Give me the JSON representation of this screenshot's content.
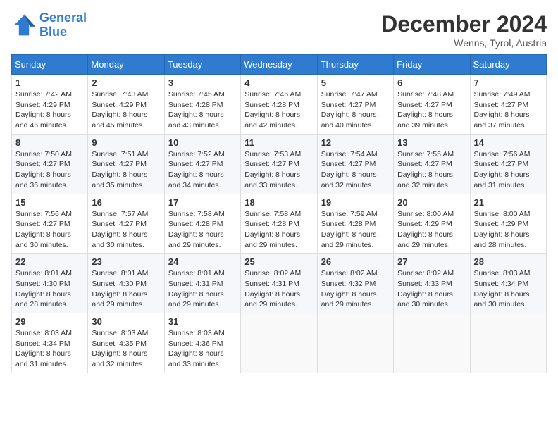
{
  "logo": {
    "line1": "General",
    "line2": "Blue"
  },
  "title": "December 2024",
  "location": "Wenns, Tyrol, Austria",
  "days_of_week": [
    "Sunday",
    "Monday",
    "Tuesday",
    "Wednesday",
    "Thursday",
    "Friday",
    "Saturday"
  ],
  "weeks": [
    [
      {
        "day": "1",
        "sunrise": "7:42 AM",
        "sunset": "4:29 PM",
        "daylight": "8 hours and 46 minutes."
      },
      {
        "day": "2",
        "sunrise": "7:43 AM",
        "sunset": "4:29 PM",
        "daylight": "8 hours and 45 minutes."
      },
      {
        "day": "3",
        "sunrise": "7:45 AM",
        "sunset": "4:28 PM",
        "daylight": "8 hours and 43 minutes."
      },
      {
        "day": "4",
        "sunrise": "7:46 AM",
        "sunset": "4:28 PM",
        "daylight": "8 hours and 42 minutes."
      },
      {
        "day": "5",
        "sunrise": "7:47 AM",
        "sunset": "4:27 PM",
        "daylight": "8 hours and 40 minutes."
      },
      {
        "day": "6",
        "sunrise": "7:48 AM",
        "sunset": "4:27 PM",
        "daylight": "8 hours and 39 minutes."
      },
      {
        "day": "7",
        "sunrise": "7:49 AM",
        "sunset": "4:27 PM",
        "daylight": "8 hours and 37 minutes."
      }
    ],
    [
      {
        "day": "8",
        "sunrise": "7:50 AM",
        "sunset": "4:27 PM",
        "daylight": "8 hours and 36 minutes."
      },
      {
        "day": "9",
        "sunrise": "7:51 AM",
        "sunset": "4:27 PM",
        "daylight": "8 hours and 35 minutes."
      },
      {
        "day": "10",
        "sunrise": "7:52 AM",
        "sunset": "4:27 PM",
        "daylight": "8 hours and 34 minutes."
      },
      {
        "day": "11",
        "sunrise": "7:53 AM",
        "sunset": "4:27 PM",
        "daylight": "8 hours and 33 minutes."
      },
      {
        "day": "12",
        "sunrise": "7:54 AM",
        "sunset": "4:27 PM",
        "daylight": "8 hours and 32 minutes."
      },
      {
        "day": "13",
        "sunrise": "7:55 AM",
        "sunset": "4:27 PM",
        "daylight": "8 hours and 32 minutes."
      },
      {
        "day": "14",
        "sunrise": "7:56 AM",
        "sunset": "4:27 PM",
        "daylight": "8 hours and 31 minutes."
      }
    ],
    [
      {
        "day": "15",
        "sunrise": "7:56 AM",
        "sunset": "4:27 PM",
        "daylight": "8 hours and 30 minutes."
      },
      {
        "day": "16",
        "sunrise": "7:57 AM",
        "sunset": "4:27 PM",
        "daylight": "8 hours and 30 minutes."
      },
      {
        "day": "17",
        "sunrise": "7:58 AM",
        "sunset": "4:28 PM",
        "daylight": "8 hours and 29 minutes."
      },
      {
        "day": "18",
        "sunrise": "7:58 AM",
        "sunset": "4:28 PM",
        "daylight": "8 hours and 29 minutes."
      },
      {
        "day": "19",
        "sunrise": "7:59 AM",
        "sunset": "4:28 PM",
        "daylight": "8 hours and 29 minutes."
      },
      {
        "day": "20",
        "sunrise": "8:00 AM",
        "sunset": "4:29 PM",
        "daylight": "8 hours and 29 minutes."
      },
      {
        "day": "21",
        "sunrise": "8:00 AM",
        "sunset": "4:29 PM",
        "daylight": "8 hours and 28 minutes."
      }
    ],
    [
      {
        "day": "22",
        "sunrise": "8:01 AM",
        "sunset": "4:30 PM",
        "daylight": "8 hours and 28 minutes."
      },
      {
        "day": "23",
        "sunrise": "8:01 AM",
        "sunset": "4:30 PM",
        "daylight": "8 hours and 29 minutes."
      },
      {
        "day": "24",
        "sunrise": "8:01 AM",
        "sunset": "4:31 PM",
        "daylight": "8 hours and 29 minutes."
      },
      {
        "day": "25",
        "sunrise": "8:02 AM",
        "sunset": "4:31 PM",
        "daylight": "8 hours and 29 minutes."
      },
      {
        "day": "26",
        "sunrise": "8:02 AM",
        "sunset": "4:32 PM",
        "daylight": "8 hours and 29 minutes."
      },
      {
        "day": "27",
        "sunrise": "8:02 AM",
        "sunset": "4:33 PM",
        "daylight": "8 hours and 30 minutes."
      },
      {
        "day": "28",
        "sunrise": "8:03 AM",
        "sunset": "4:34 PM",
        "daylight": "8 hours and 30 minutes."
      }
    ],
    [
      {
        "day": "29",
        "sunrise": "8:03 AM",
        "sunset": "4:34 PM",
        "daylight": "8 hours and 31 minutes."
      },
      {
        "day": "30",
        "sunrise": "8:03 AM",
        "sunset": "4:35 PM",
        "daylight": "8 hours and 32 minutes."
      },
      {
        "day": "31",
        "sunrise": "8:03 AM",
        "sunset": "4:36 PM",
        "daylight": "8 hours and 33 minutes."
      },
      null,
      null,
      null,
      null
    ]
  ]
}
